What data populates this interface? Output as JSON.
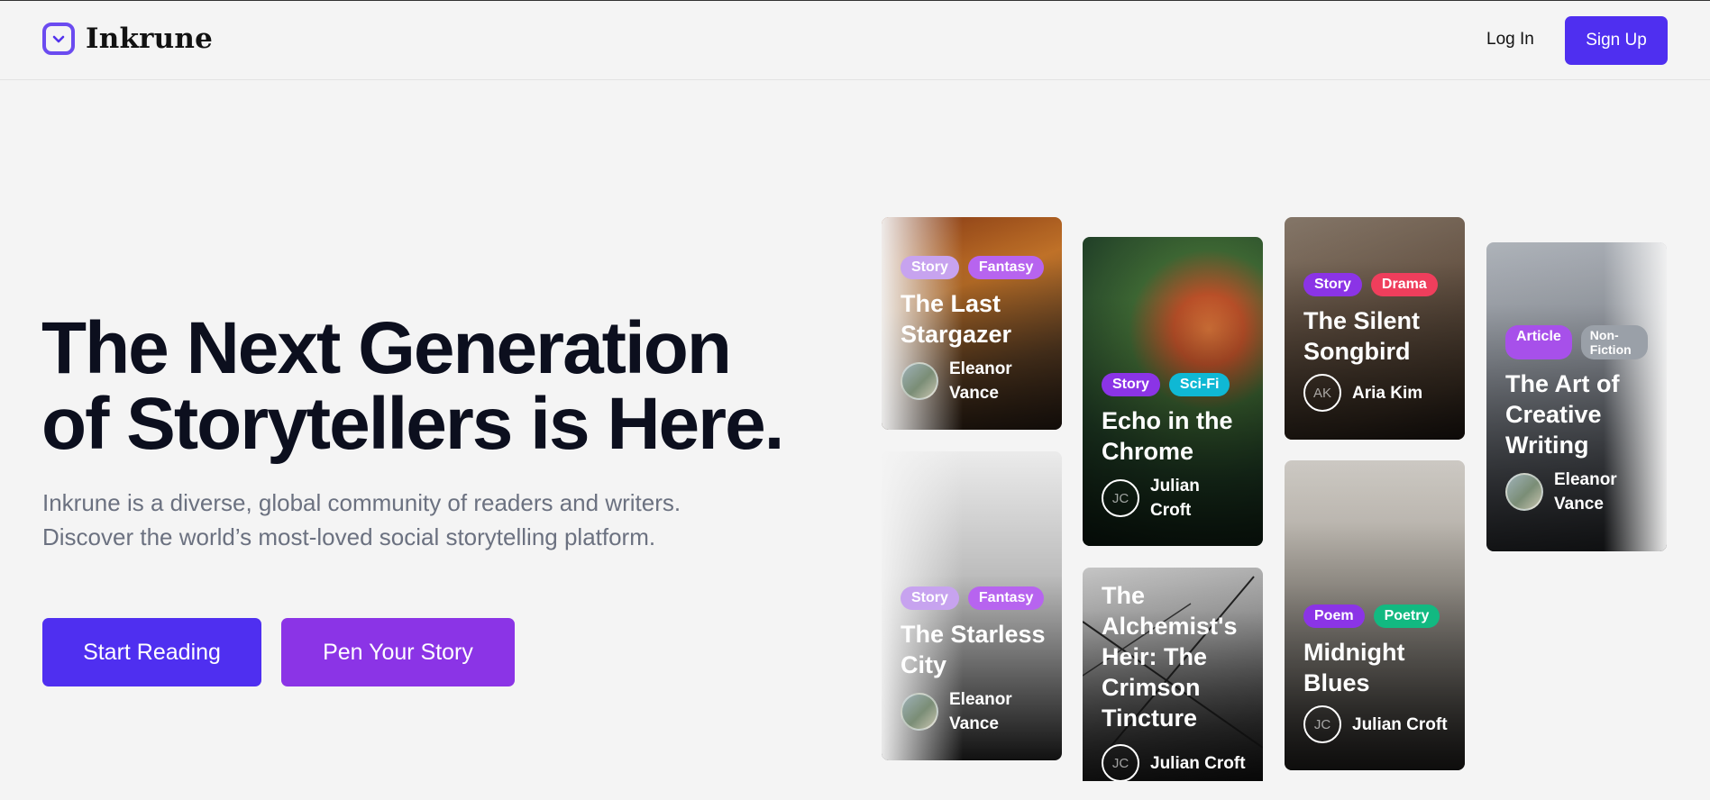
{
  "brand": {
    "name": "Inkrune"
  },
  "nav": {
    "login": "Log In",
    "signup": "Sign Up"
  },
  "hero": {
    "title_line1": "The Next Generation",
    "title_line2": "of Storytellers is Here.",
    "subtitle": "Inkrune is a diverse, global community of readers and writers. Discover the world’s most-loved social storytelling platform.",
    "cta_primary": "Start Reading",
    "cta_secondary": "Pen Your Story"
  },
  "colors": {
    "accent": "#4f2ff0",
    "secondary": "#8b34e6",
    "tag_story": "#8b34e6",
    "tag_scifi": "#0fb8d4",
    "tag_drama": "#ef3e5c",
    "tag_poetry": "#12b981",
    "tag_nonfiction": "#9aa0a8"
  },
  "cards": [
    {
      "tags": [
        "Story",
        "Fantasy"
      ],
      "title": "The Last Stargazer",
      "author": "Eleanor Vance"
    },
    {
      "tags": [
        "Story",
        "Fantasy"
      ],
      "title": "The Starless City",
      "author": "Eleanor Vance"
    },
    {
      "tags": [
        "Story",
        "Sci-Fi"
      ],
      "title": "Echo in the Chrome",
      "author": "Julian Croft",
      "initials": "JC"
    },
    {
      "tags": [],
      "title": "The Alchemist's Heir: The Crimson Tincture",
      "author": "Julian Croft",
      "initials": "JC"
    },
    {
      "tags": [
        "Story",
        "Drama"
      ],
      "title": "The Silent Songbird",
      "author": "Aria Kim",
      "initials": "AK"
    },
    {
      "tags": [
        "Poem",
        "Poetry"
      ],
      "title": "Midnight Blues",
      "author": "Julian Croft",
      "initials": "JC"
    },
    {
      "tags": [
        "Article",
        "Non-Fiction"
      ],
      "title": "The Art of Creative Writing",
      "author": "Eleanor Vance"
    }
  ]
}
